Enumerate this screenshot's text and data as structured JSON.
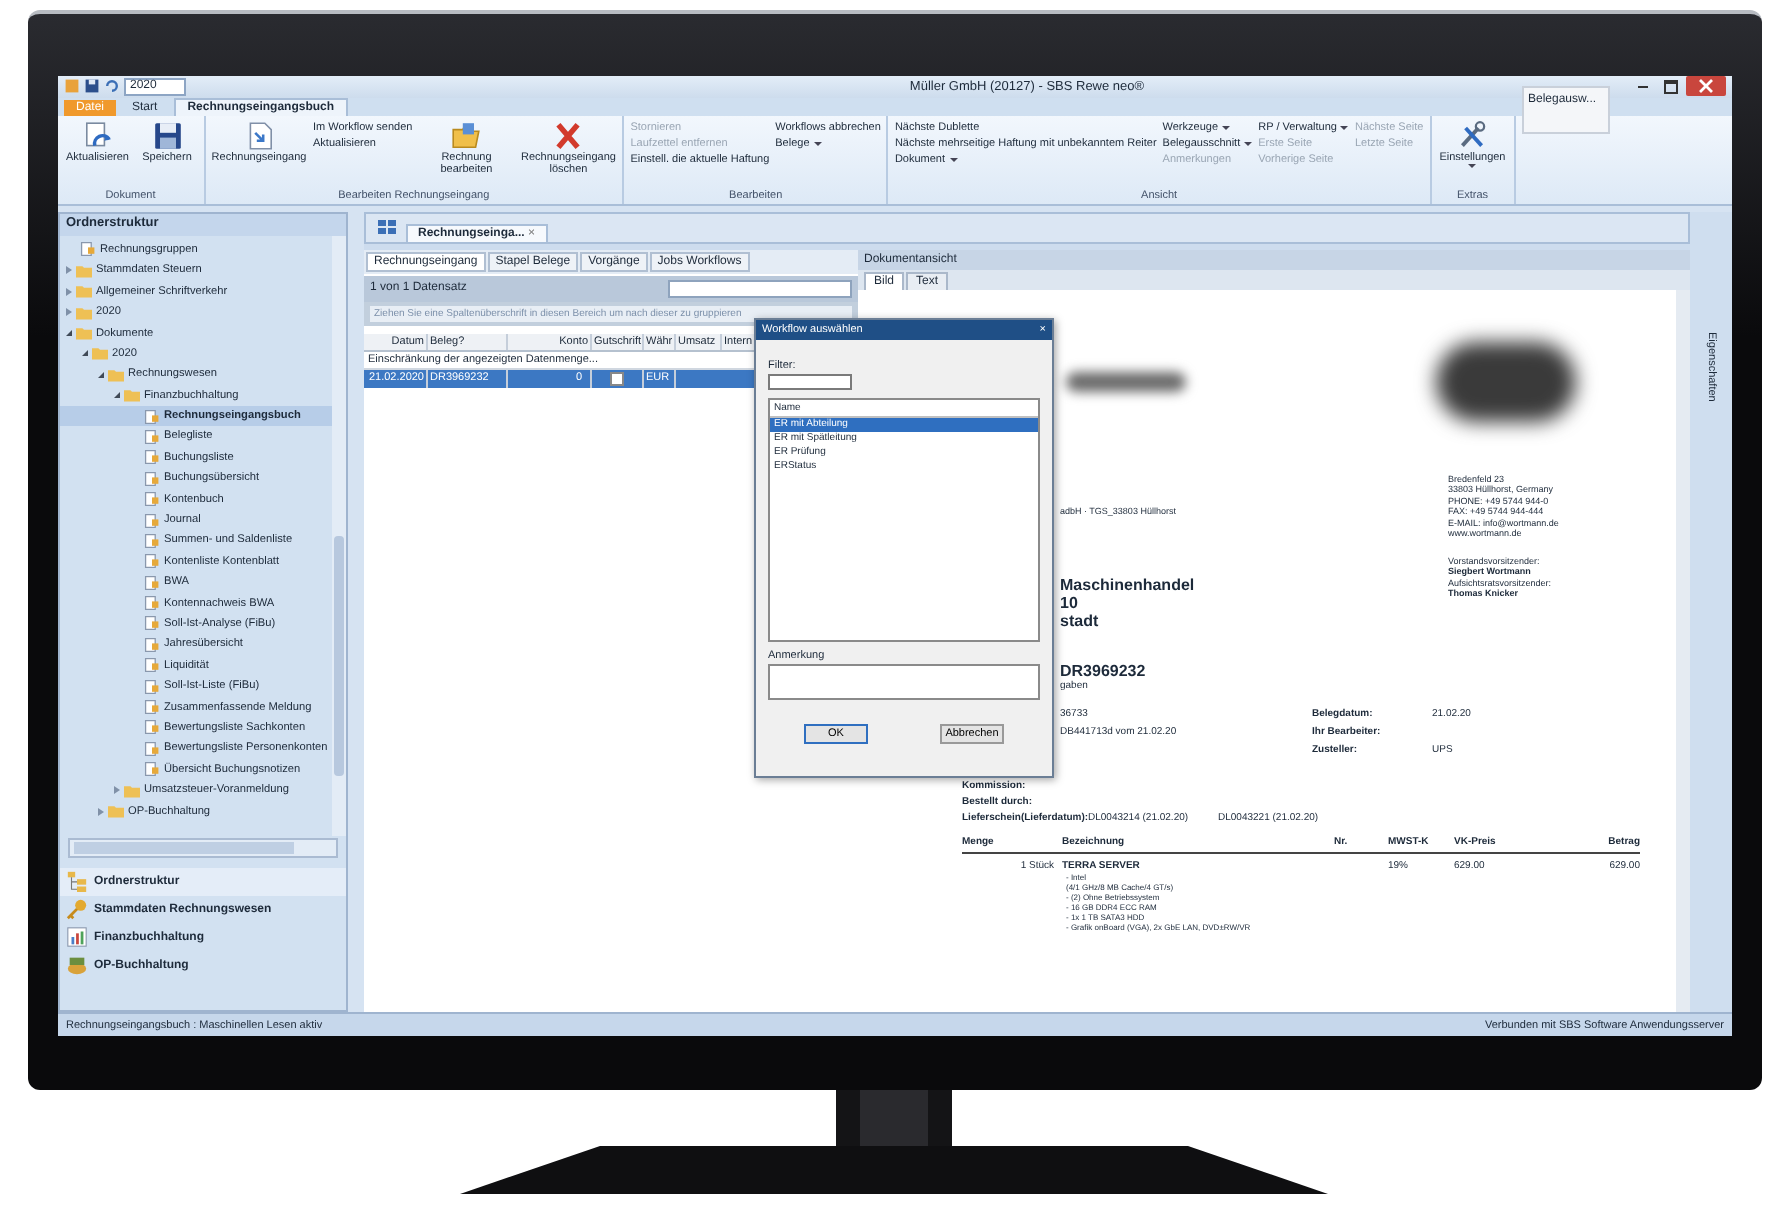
{
  "window": {
    "title": "Müller GmbH (20127) - SBS Rewe neo®",
    "quick_combo": "2020"
  },
  "tooltip": "Belegausw...",
  "ribbon_tabs": [
    {
      "label": "Datei",
      "kind": "file",
      "selected": false
    },
    {
      "label": "Start",
      "kind": "tab",
      "selected": false
    },
    {
      "label": "Rechnungseingangsbuch",
      "kind": "tab",
      "selected": true
    }
  ],
  "ribbon_groups": [
    {
      "label": "Dokument",
      "columns": [
        {
          "kind": "large",
          "label": "Aktualisieren"
        },
        {
          "kind": "large",
          "label": "Speichern"
        }
      ]
    },
    {
      "label": "Bearbeiten Rechnungseingang",
      "columns": [
        {
          "kind": "large",
          "label": "Rechnungseingang"
        },
        {
          "kind": "stack",
          "items": [
            {
              "label": "Im Workflow senden",
              "disabled": false
            },
            {
              "label": "Aktualisieren",
              "disabled": false
            }
          ]
        },
        {
          "kind": "large",
          "label": "Rechnung bearbeiten"
        },
        {
          "kind": "large",
          "label": "Rechnungseingang löschen"
        }
      ]
    },
    {
      "label": "Bearbeiten",
      "columns": [
        {
          "kind": "stack",
          "items": [
            {
              "label": "Stornieren",
              "disabled": true
            },
            {
              "label": "Laufzettel entfernen",
              "disabled": true
            },
            {
              "label": "Einstell. die aktuelle Haftung",
              "disabled": false
            }
          ]
        },
        {
          "kind": "stack",
          "items": [
            {
              "label": "Workflows abbrechen",
              "disabled": false
            },
            {
              "label": "Belege",
              "disabled": false,
              "dropdown": true
            }
          ]
        }
      ]
    },
    {
      "label": "Ansicht",
      "columns": [
        {
          "kind": "stack",
          "items": [
            {
              "label": "Nächste Dublette",
              "disabled": false
            },
            {
              "label": "Nächste mehrseitige Haftung mit unbekanntem Reiter",
              "disabled": false
            },
            {
              "label": "Dokument",
              "disabled": false,
              "dropdown": true
            }
          ]
        },
        {
          "kind": "stack",
          "items": [
            {
              "label": "Werkzeuge",
              "disabled": false,
              "dropdown": true
            },
            {
              "label": "Belegausschnitt",
              "disabled": false,
              "dropdown": true
            },
            {
              "label": "Anmerkungen",
              "disabled": true
            }
          ]
        },
        {
          "kind": "stack",
          "items": [
            {
              "label": "RP / Verwaltung",
              "disabled": false,
              "dropdown": true
            },
            {
              "label": "Erste Seite",
              "disabled": true
            },
            {
              "label": "Vorherige Seite",
              "disabled": true
            }
          ]
        },
        {
          "kind": "stack",
          "items": [
            {
              "label": "Nächste Seite",
              "disabled": true
            },
            {
              "label": "Letzte Seite",
              "disabled": true
            }
          ]
        }
      ]
    },
    {
      "label": "Extras",
      "columns": [
        {
          "kind": "large",
          "label": "Einstellungen",
          "dropdown": true
        }
      ]
    }
  ],
  "sidebar": {
    "title": "Ordnerstruktur",
    "tree": [
      {
        "label": "Rechnungsgruppen",
        "kind": "report",
        "selected": false
      },
      {
        "label": "Stammdaten Steuern",
        "kind": "folder",
        "expanded": false,
        "selected": false
      },
      {
        "label": "Allgemeiner Schriftverkehr",
        "kind": "folder",
        "expanded": false,
        "selected": false
      },
      {
        "label": "2020",
        "kind": "folder",
        "expanded": false,
        "selected": false
      },
      {
        "label": "Dokumente",
        "kind": "folder",
        "expanded": true,
        "selected": false,
        "children": [
          {
            "label": "2020",
            "kind": "folder",
            "expanded": true,
            "selected": false,
            "children": [
              {
                "label": "Rechnungswesen",
                "kind": "folder",
                "expanded": true,
                "selected": false,
                "children": [
                  {
                    "label": "Finanzbuchhaltung",
                    "kind": "folder",
                    "expanded": true,
                    "selected": false,
                    "children": [
                      {
                        "label": "Rechnungseingangsbuch",
                        "kind": "report",
                        "selected": true
                      },
                      {
                        "label": "Belegliste",
                        "kind": "report",
                        "selected": false
                      },
                      {
                        "label": "Buchungsliste",
                        "kind": "report",
                        "selected": false
                      },
                      {
                        "label": "Buchungsübersicht",
                        "kind": "report",
                        "selected": false
                      },
                      {
                        "label": "Kontenbuch",
                        "kind": "report",
                        "selected": false
                      },
                      {
                        "label": "Journal",
                        "kind": "report",
                        "selected": false
                      },
                      {
                        "label": "Summen- und Saldenliste",
                        "kind": "report",
                        "selected": false
                      },
                      {
                        "label": "Kontenliste Kontenblatt",
                        "kind": "report",
                        "selected": false
                      },
                      {
                        "label": "BWA",
                        "kind": "report",
                        "selected": false
                      },
                      {
                        "label": "Kontennachweis BWA",
                        "kind": "report",
                        "selected": false
                      },
                      {
                        "label": "Soll-Ist-Analyse (FiBu)",
                        "kind": "report",
                        "selected": false
                      },
                      {
                        "label": "Jahresübersicht",
                        "kind": "report",
                        "selected": false
                      },
                      {
                        "label": "Liquidität",
                        "kind": "report",
                        "selected": false
                      },
                      {
                        "label": "Soll-Ist-Liste (FiBu)",
                        "kind": "report",
                        "selected": false
                      },
                      {
                        "label": "Zusammenfassende Meldung",
                        "kind": "report",
                        "selected": false
                      },
                      {
                        "label": "Bewertungsliste Sachkonten",
                        "kind": "report",
                        "selected": false
                      },
                      {
                        "label": "Bewertungsliste Personenkonten",
                        "kind": "report",
                        "selected": false
                      },
                      {
                        "label": "Übersicht Buchungsnotizen",
                        "kind": "report",
                        "selected": false
                      }
                    ]
                  },
                  {
                    "label": "Umsatzsteuer-Voranmeldung",
                    "kind": "folder",
                    "expanded": false,
                    "selected": false
                  }
                ]
              },
              {
                "label": "OP-Buchhaltung",
                "kind": "folder",
                "expanded": false,
                "selected": false
              }
            ]
          }
        ]
      }
    ],
    "nav": [
      {
        "label": "Ordnerstruktur",
        "selected": true
      },
      {
        "label": "Stammdaten Rechnungswesen",
        "selected": false
      },
      {
        "label": "Finanzbuchhaltung",
        "selected": false
      },
      {
        "label": "OP-Buchhaltung",
        "selected": false
      }
    ]
  },
  "doc_tab": {
    "label": "Rechnungseinga...",
    "close": "×"
  },
  "grid": {
    "tabs": [
      {
        "label": "Rechnungseingang",
        "selected": true
      },
      {
        "label": "Stapel Belege",
        "selected": false
      },
      {
        "label": "Vorgänge",
        "selected": false
      },
      {
        "label": "Jobs Workflows",
        "selected": false
      }
    ],
    "record_count": "1 von 1 Datensatz",
    "group_hint": "Ziehen Sie eine Spaltenüberschrift in diesen Bereich um nach dieser zu gruppieren",
    "columns": [
      "Datum",
      "Beleg?",
      "Konto",
      "Gutschrift",
      "Währ",
      "Umsatz",
      "Intern"
    ],
    "filter_row": "Einschränkung der angezeigten Datenmenge...",
    "rows": [
      {
        "date": "21.02.2020",
        "number": "DR3969232",
        "account": "0",
        "credit_note": false,
        "currency": "EUR",
        "selected": true
      }
    ]
  },
  "dialog": {
    "title": "Workflow auswählen",
    "close": "×",
    "filter_label": "Filter:",
    "list_header": "Name",
    "workflows": [
      {
        "label": "ER mit Abteilung",
        "selected": true
      },
      {
        "label": "ER mit Spätleitung",
        "selected": false
      },
      {
        "label": "ER Prüfung",
        "selected": false
      },
      {
        "label": "ERStatus",
        "selected": false
      }
    ],
    "note_label": "Anmerkung",
    "buttons": [
      "OK",
      "Abbrechen"
    ]
  },
  "document": {
    "title": "Dokumentansicht",
    "tabs": [
      {
        "label": "Bild",
        "selected": true
      },
      {
        "label": "Text",
        "selected": false
      }
    ],
    "sender_line": "adbH · TGS_33803 Hüllhorst",
    "recipient": [
      "Maschinenhandel",
      "10",
      "stadt"
    ],
    "company_address": [
      "Bredenfeld 23",
      "33803 Hüllhorst, Germany",
      "PHONE: +49 5744 944-0",
      "FAX: +49 5744 944-444",
      "E-MAIL: info@wortmann.de",
      "www.wortmann.de"
    ],
    "management": [
      "Vorstandsvorsitzender:",
      "Siegbert Wortmann",
      "Aufsichtsratsvorsitzender:",
      "Thomas Knicker"
    ],
    "number": "DR3969232",
    "number_note": "gaben",
    "references": [
      "36733",
      "DB441713d vom 21.02.20"
    ],
    "meta_right": [
      {
        "label": "Belegdatum:",
        "value": "21.02.20"
      },
      {
        "label": "Ihr Bearbeiter:"
      },
      {
        "label": "Zusteller:",
        "value": "UPS"
      }
    ],
    "meta_left": [
      "Kommission:",
      "Bestellt durch:"
    ],
    "delivery": {
      "label": "Lieferschein(Lieferdatum):",
      "values": [
        "DL0043214 (21.02.20)",
        "DL0043221 (21.02.20)"
      ]
    },
    "columns": [
      "Menge",
      "Bezeichnung",
      "Nr.",
      "MWST-K",
      "VK-Preis",
      "Betrag"
    ],
    "items": [
      {
        "qty": "1 Stück",
        "name": "TERRA SERVER",
        "tax": "19%",
        "price": "629.00",
        "amount": "629.00",
        "details": [
          "- Intel",
          "(4/1 GHz/8 MB Cache/4 GT/s)",
          "- (2) Ohne Betriebssystem",
          "- 16 GB DDR4 ECC RAM",
          "- 1x 1 TB SATA3 HDD",
          "- Grafik onBoard (VGA), 2x GbE LAN, DVD±RW/VR"
        ]
      }
    ]
  },
  "side_strip": [
    "Eigenschaften"
  ],
  "status_bar": {
    "left": "Rechnungseingangsbuch : Maschinellen Lesen aktiv",
    "right": "Verbunden mit SBS Software Anwendungsserver"
  }
}
